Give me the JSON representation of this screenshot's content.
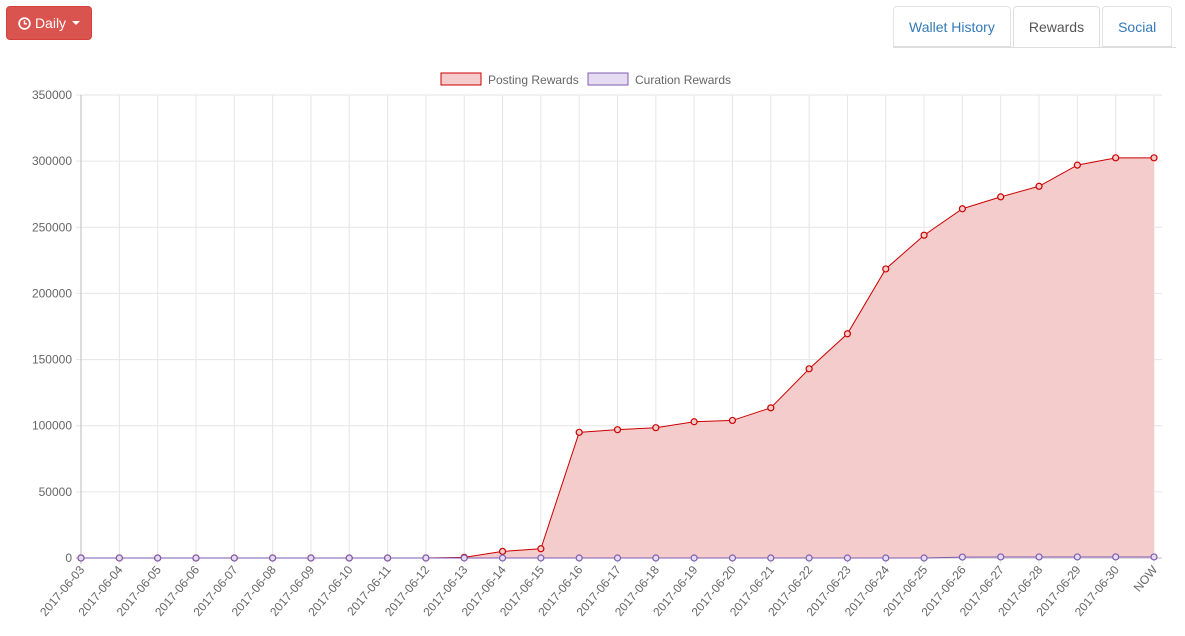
{
  "toolbar": {
    "period_label": "Daily",
    "period_icon": "clock-icon"
  },
  "tabs": [
    {
      "label": "Wallet History",
      "active": false
    },
    {
      "label": "Rewards",
      "active": true
    },
    {
      "label": "Social",
      "active": false
    }
  ],
  "colors": {
    "posting_line": "#cc0000",
    "posting_fill": "#f4cccc",
    "curation_line": "#7e5bb0",
    "curation_fill": "#e5dcf2",
    "button": "#d9534f",
    "link": "#337ab7"
  },
  "chart_data": {
    "type": "area",
    "categories": [
      "2017-06-03",
      "2017-06-04",
      "2017-06-05",
      "2017-06-06",
      "2017-06-07",
      "2017-06-08",
      "2017-06-09",
      "2017-06-10",
      "2017-06-11",
      "2017-06-12",
      "2017-06-13",
      "2017-06-14",
      "2017-06-15",
      "2017-06-16",
      "2017-06-17",
      "2017-06-18",
      "2017-06-19",
      "2017-06-20",
      "2017-06-21",
      "2017-06-22",
      "2017-06-23",
      "2017-06-24",
      "2017-06-25",
      "2017-06-26",
      "2017-06-27",
      "2017-06-28",
      "2017-06-29",
      "2017-06-30",
      "NOW"
    ],
    "series": [
      {
        "name": "Posting Rewards",
        "values": [
          0,
          0,
          0,
          0,
          0,
          0,
          0,
          0,
          0,
          0,
          500,
          5000,
          7000,
          95000,
          97000,
          98500,
          103000,
          104000,
          113500,
          143000,
          169500,
          218500,
          244000,
          264000,
          273000,
          281000,
          297000,
          302500,
          302500
        ]
      },
      {
        "name": "Curation Rewards",
        "values": [
          0,
          0,
          0,
          0,
          0,
          0,
          0,
          0,
          0,
          0,
          0,
          0,
          0,
          0,
          0,
          0,
          0,
          0,
          0,
          0,
          0,
          0,
          0,
          700,
          800,
          800,
          800,
          800,
          800
        ]
      }
    ],
    "yticks": [
      "0",
      "50000",
      "100000",
      "150000",
      "200000",
      "250000",
      "300000",
      "350000"
    ],
    "ylim": [
      0,
      350000
    ],
    "grid": true,
    "legend_position": "top"
  }
}
